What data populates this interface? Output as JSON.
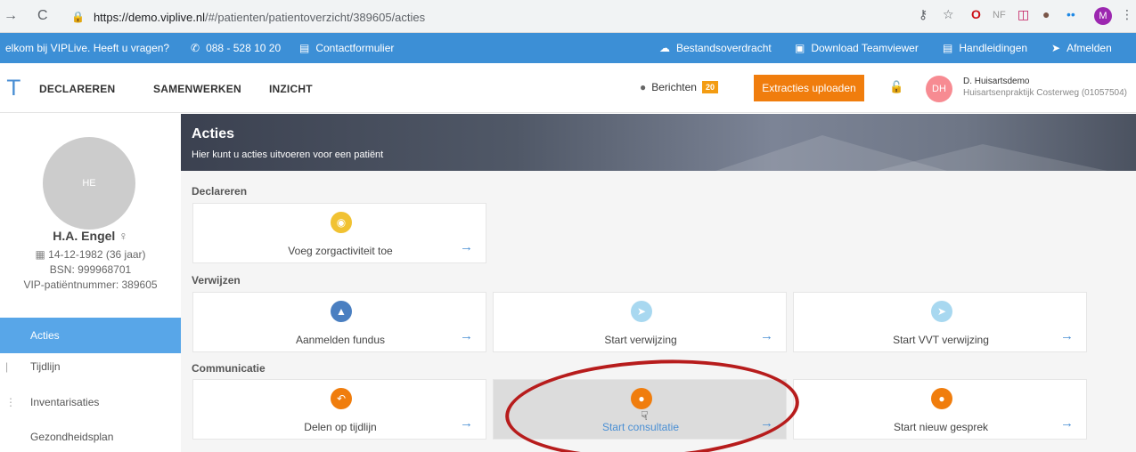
{
  "browser": {
    "nav_back": "→",
    "reload": "C",
    "url_host": "https://demo.viplive.nl",
    "url_path": "/#/patienten/patientoverzicht/389605/acties",
    "ext_nf": "NF",
    "avatar_letter": "M"
  },
  "infobar": {
    "welcome": "elkom bij VIPLive. Heeft u vragen?",
    "phone": "088 - 528 10 20",
    "contact": "Contactformulier",
    "transfer": "Bestandsoverdracht",
    "teamviewer": "Download Teamviewer",
    "manuals": "Handleidingen",
    "logout": "Afmelden"
  },
  "nav": {
    "logo": "T",
    "declareren": "DECLAREREN",
    "samenwerken": "SAMENWERKEN",
    "inzicht": "INZICHT",
    "berichten": "Berichten",
    "berichten_count": "20",
    "extracties": "Extracties uploaden",
    "user_initials": "DH",
    "user_name": "D. Huisartsdemo",
    "user_practice": "Huisartsenpraktijk Costerweg (01057504)"
  },
  "patient": {
    "initials": "HE",
    "name": "H.A. Engel",
    "gender_symbol": "♀",
    "dob": "14-12-1982 (36 jaar)",
    "bsn": "BSN: 999968701",
    "vip_number": "VIP-patiëntnummer: 389605"
  },
  "sidebar": {
    "items": [
      {
        "label": "Acties"
      },
      {
        "label": "Tijdlijn"
      },
      {
        "label": "Inventarisaties"
      },
      {
        "label": "Gezondheidsplan"
      }
    ]
  },
  "banner": {
    "title": "Acties",
    "subtitle": "Hier kunt u acties uitvoeren voor een patiënt"
  },
  "sections": {
    "declareren": "Declareren",
    "verwijzen": "Verwijzen",
    "communicatie": "Communicatie"
  },
  "cards": {
    "voeg_zorgactiviteit": "Voeg zorgactiviteit toe",
    "aanmelden_fundus": "Aanmelden fundus",
    "start_verwijzing": "Start verwijzing",
    "start_vvt": "Start VVT verwijzing",
    "delen_tijdlijn": "Delen op tijdlijn",
    "start_consultatie": "Start consultatie",
    "start_gesprek": "Start nieuw gesprek"
  },
  "colors": {
    "accent_blue": "#3c8fd6",
    "orange": "#f07d0d",
    "yellow": "#f1c232",
    "light_blue": "#a8d8f0",
    "dark_blue": "#4a7fc1",
    "annotation_red": "#b71c1c"
  },
  "icons": {
    "arrow": "→"
  }
}
